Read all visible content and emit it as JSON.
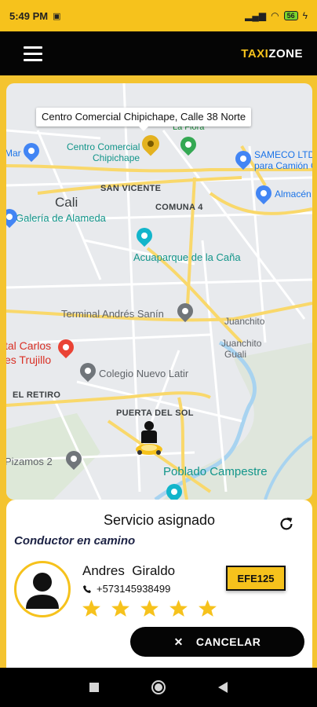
{
  "status_bar": {
    "time": "5:49 PM",
    "battery": "56"
  },
  "app": {
    "brand_part1": "TAXI",
    "brand_part2": "ZONE"
  },
  "map": {
    "tooltip": "Centro Comercial Chipichape, Calle 38 Norte",
    "labels": {
      "la_flora": "La Flora",
      "cc_chipichape_1": "Centro Comercial",
      "cc_chipichape_2": "Chipichape",
      "mar": "Mar",
      "sameco_1": "SAMECO LTDA",
      "sameco_2": "para Camión C",
      "cali": "Cali",
      "san_vicente": "SAN VICENTE",
      "almacen": "Almacén",
      "galeria": "Galería de Alameda",
      "comuna4": "COMUNA 4",
      "acuaparque": "Acuaparque de la Caña",
      "terminal": "Terminal Andrés Sanín",
      "juanchito": "Juanchito",
      "juanchito_guali_1": "Juanchito",
      "juanchito_guali_2": "Guali",
      "hospital_1": "tal Carlos",
      "hospital_2": "es Trujillo",
      "colegio": "Colegio Nuevo Latir",
      "el_retiro": "EL RETIRO",
      "puerta_del_sol": "PUERTA DEL SOL",
      "pizamos": "Pizamos 2",
      "poblado": "Poblado Campestre"
    },
    "pins": {
      "mar": "shopping-icon",
      "la_flora": "tree-icon",
      "sameco": "store-icon",
      "almacen": "store-icon",
      "galeria": "store-icon",
      "acuaparque": "park-icon",
      "terminal": "location-icon",
      "hospital": "hospital-icon",
      "colegio": "location-icon",
      "pizamos": "park-icon",
      "poblado": "camera-icon"
    }
  },
  "card": {
    "title": "Servicio asignado",
    "subtitle": "Conductor en camino",
    "driver_name": "Andres  Giraldo",
    "phone": "+573145938499",
    "rating": 5,
    "plate": "EFE125",
    "cancel_label": "CANCELAR"
  },
  "colors": {
    "accent": "#f6c21c",
    "dark": "#050505",
    "map_bg": "#e8eaed",
    "road_yellow": "#f9d86b",
    "water": "#a8d3f0"
  }
}
